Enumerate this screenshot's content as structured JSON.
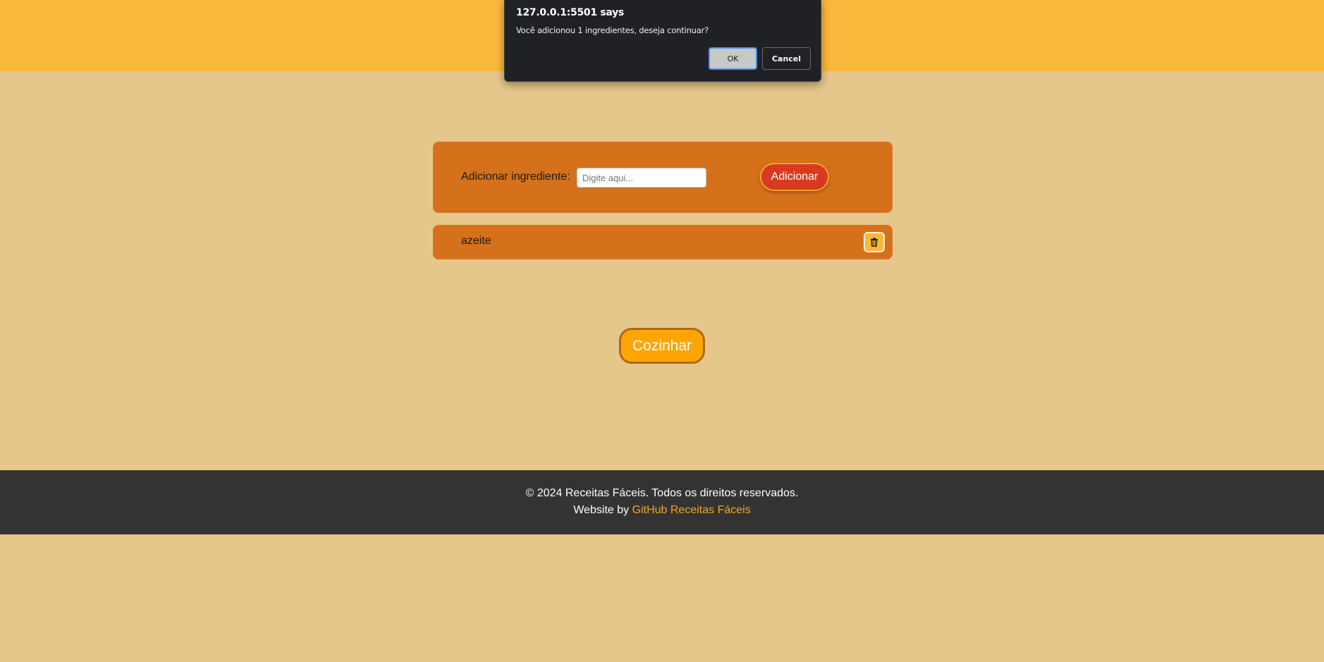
{
  "form": {
    "label": "Adicionar ingrediente:",
    "input_placeholder": "Digite aqui...",
    "input_value": "",
    "add_label": "Adicionar"
  },
  "ingredients": [
    {
      "name": "azeite",
      "delete_icon": "trash-icon"
    }
  ],
  "cook_label": "Cozinhar",
  "footer": {
    "copyright": "© 2024 Receitas Fáceis. Todos os direitos reservados.",
    "credit_prefix": "Website by",
    "credit_link": "GitHub Receitas Fáceis"
  },
  "dialog": {
    "title": "127.0.0.1:5501 says",
    "message": "Você adicionou 1 ingredientes, deseja continuar?",
    "ok_label": "OK",
    "cancel_label": "Cancel"
  },
  "colors": {
    "page_bg": "#e6c78b",
    "header_bg": "#f9b83c",
    "panel_bg": "#d5711b",
    "add_button": "#d93a1f",
    "cook_button": "#ffa500",
    "footer_bg": "#333333",
    "footer_link": "#f5a623"
  }
}
